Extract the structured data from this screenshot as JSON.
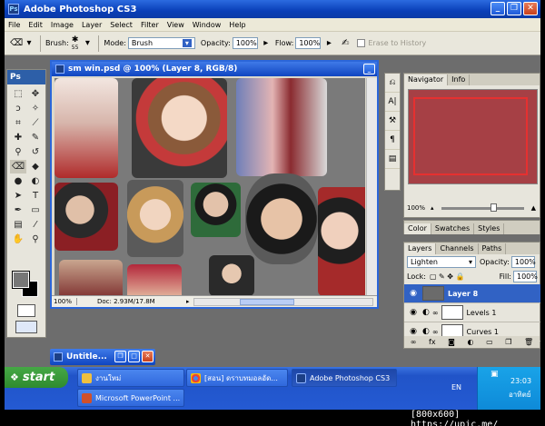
{
  "window": {
    "app_title": "Adobe Photoshop CS3",
    "app_icon": "Ps"
  },
  "menu": [
    "File",
    "Edit",
    "Image",
    "Layer",
    "Select",
    "Filter",
    "View",
    "Window",
    "Help"
  ],
  "options": {
    "brush_label": "Brush:",
    "brush_size": "55",
    "mode_label": "Mode:",
    "mode_value": "Brush",
    "opacity_label": "Opacity:",
    "opacity_value": "100%",
    "flow_label": "Flow:",
    "flow_value": "100%",
    "erase_history": "Erase to History"
  },
  "tools": {
    "header": "Ps"
  },
  "document": {
    "title": "sm win.psd @ 100% (Layer 8, RGB/8)",
    "zoom": "100%",
    "doc_info": "Doc: 2.93M/17.8M"
  },
  "navigator": {
    "tabs": [
      "Navigator",
      "Info"
    ],
    "zoom": "100%"
  },
  "color_panel": {
    "tabs": [
      "Color",
      "Swatches",
      "Styles"
    ]
  },
  "layers": {
    "tabs": [
      "Layers",
      "Channels",
      "Paths"
    ],
    "blend_mode": "Lighten",
    "opacity_label": "Opacity:",
    "opacity_value": "100%",
    "lock_label": "Lock:",
    "fill_label": "Fill:",
    "fill_value": "100%",
    "items": [
      {
        "name": "Layer 8",
        "selected": true
      },
      {
        "name": "Levels 1",
        "selected": false
      },
      {
        "name": "Curves 1",
        "selected": false
      }
    ]
  },
  "minimized_window": {
    "title": "Untitle..."
  },
  "taskbar": {
    "start": "start",
    "tasks": [
      {
        "label": "งานใหม่"
      },
      {
        "label": "[สอน] ดราบทมอลอัด..."
      },
      {
        "label": "Adobe Photoshop CS3"
      },
      {
        "label": "Microsoft PowerPoint ..."
      }
    ],
    "lang": "EN",
    "time": "23:03",
    "day": "อาทิตย์"
  },
  "watermark": "[800x600] https://upic.me/"
}
